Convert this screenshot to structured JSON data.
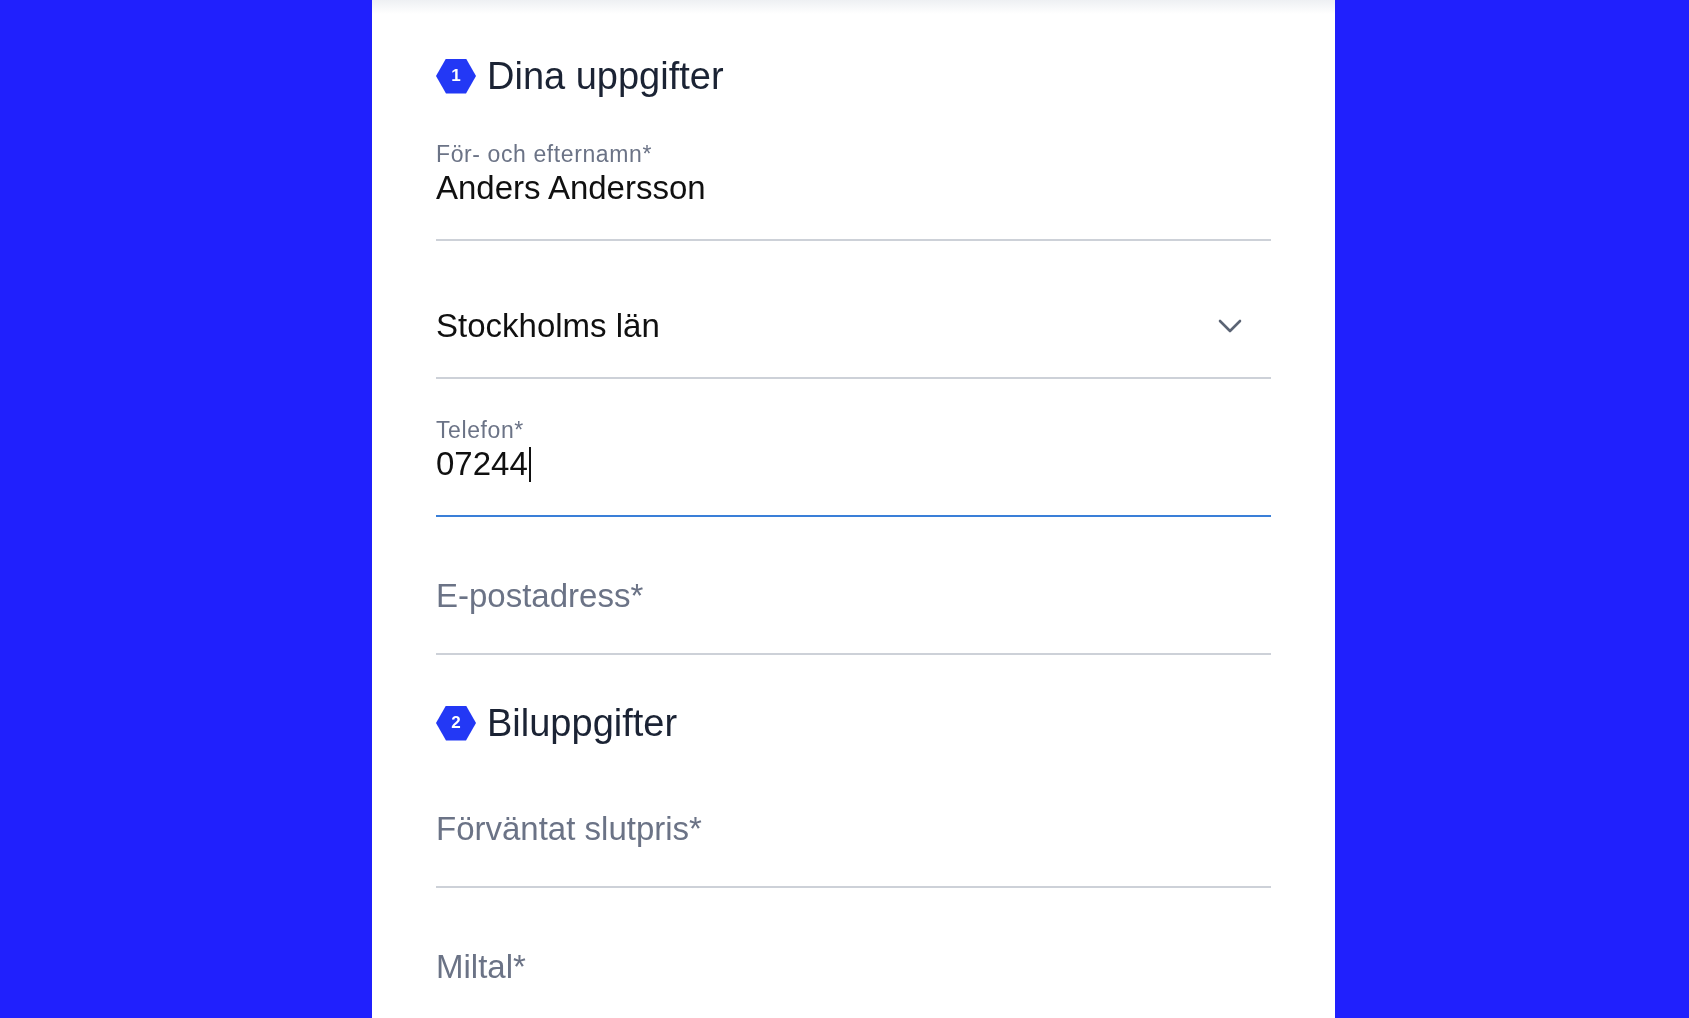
{
  "sections": [
    {
      "number": "1",
      "title": "Dina uppgifter",
      "fields": [
        {
          "kind": "text",
          "label": "För- och efternamn*",
          "value": "Anders Andersson",
          "focused": false
        },
        {
          "kind": "select",
          "value": "Stockholms län",
          "focused": false
        },
        {
          "kind": "text",
          "label": "Telefon*",
          "value": "07244",
          "focused": true
        },
        {
          "kind": "text",
          "placeholder": "E-postadress*",
          "focused": false
        }
      ]
    },
    {
      "number": "2",
      "title": "Biluppgifter",
      "fields": [
        {
          "kind": "text",
          "placeholder": "Förväntat slutpris*",
          "focused": false
        },
        {
          "kind": "text",
          "placeholder": "Miltal*"
        }
      ]
    }
  ]
}
